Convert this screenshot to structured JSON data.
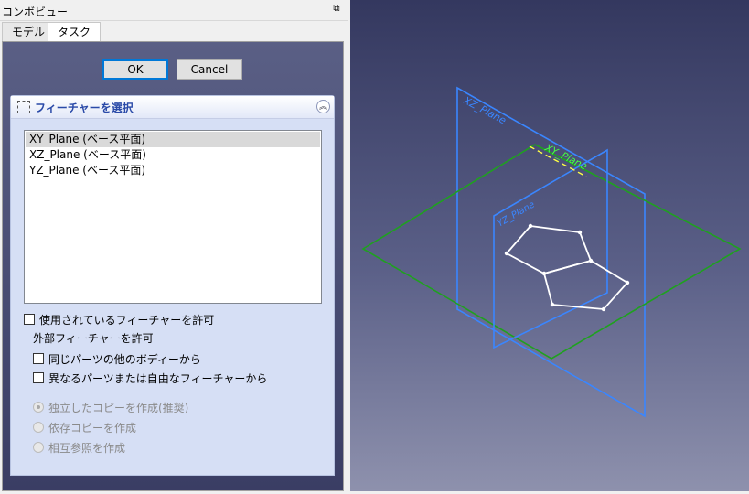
{
  "panel": {
    "title": "コンボビュー",
    "float_icon": "float-window-icon",
    "tabs": [
      {
        "label": "モデル",
        "active": false
      },
      {
        "label": "タスク",
        "active": true
      }
    ]
  },
  "dialog": {
    "ok_label": "OK",
    "cancel_label": "Cancel"
  },
  "section": {
    "title": "フィーチャーを選択",
    "icon": "select-feature-icon",
    "list_items": [
      {
        "label": "XY_Plane (ベース平面)",
        "selected": true
      },
      {
        "label": "XZ_Plane (ベース平面)",
        "selected": false
      },
      {
        "label": "YZ_Plane (ベース平面)",
        "selected": false
      }
    ],
    "allow_used_label": "使用されているフィーチャーを許可",
    "external_label": "外部フィーチャーを許可",
    "same_part_label": "同じパーツの他のボディーから",
    "different_part_label": "異なるパーツまたは自由なフィーチャーから",
    "radios": [
      {
        "label": "独立したコピーを作成(推奨)",
        "checked": true
      },
      {
        "label": "依存コピーを作成",
        "checked": false
      },
      {
        "label": "相互参照を作成",
        "checked": false
      }
    ]
  },
  "viewport": {
    "plane_labels": {
      "xy": "XY_Plane",
      "xz": "XZ_Plane",
      "yz": "YZ_Plane"
    },
    "colors": {
      "xy_plane": "#1fa11f",
      "vertical_planes": "#3a86ff",
      "sketch": "#ffffff",
      "highlight": "#ffff44"
    }
  }
}
